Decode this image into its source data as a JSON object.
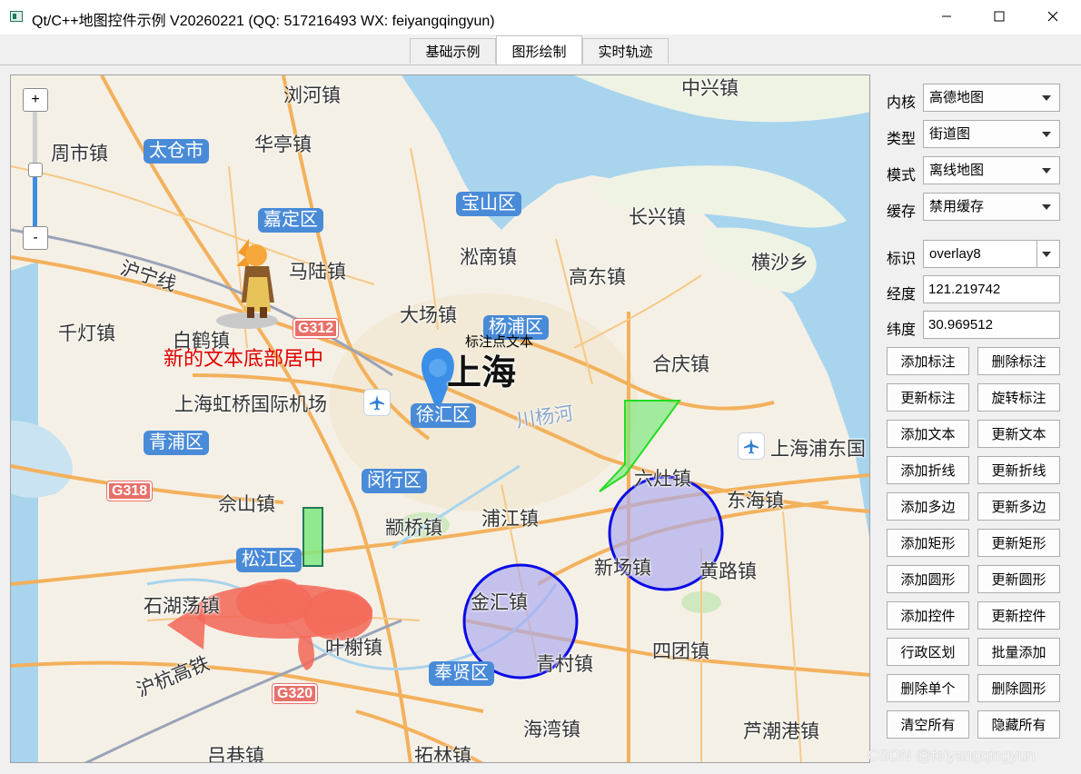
{
  "window": {
    "title": "Qt/C++地图控件示例 V20260221 (QQ: 517216493 WX: feiyangqingyun)"
  },
  "tabs": [
    {
      "label": "基础示例",
      "active": false
    },
    {
      "label": "图形绘制",
      "active": true
    },
    {
      "label": "实时轨迹",
      "active": false
    }
  ],
  "map": {
    "zoom_in": "+",
    "zoom_out": "-",
    "zoom_level_fraction": 0.5,
    "places": [
      "浏河镇",
      "中兴镇",
      "周市镇",
      "太仓市",
      "华亭镇",
      "宝山区",
      "长兴镇",
      "嘉定区",
      "淞南镇",
      "横沙乡",
      "沪宁线",
      "马陆镇",
      "高东镇",
      "千灯镇",
      "白鹤镇",
      "G312",
      "大场镇",
      "杨浦区",
      "上海",
      "合庆镇",
      "上海虹桥国际机场",
      "徐汇区",
      "川杨河",
      "青浦区",
      "上海浦东国",
      "闵行区",
      "六灶镇",
      "G318",
      "佘山镇",
      "东海镇",
      "颛桥镇",
      "浦江镇",
      "松江区",
      "新场镇",
      "黄路镇",
      "石湖荡镇",
      "金汇镇",
      "叶榭镇",
      "青村镇",
      "四团镇",
      "沪杭高铁",
      "奉贤区",
      "G320",
      "海湾镇",
      "芦潮港镇",
      "吕巷镇",
      "拓林镇"
    ],
    "marker_label": "标注点文本",
    "red_text": "新的文本底部居中",
    "watermark": "CSDN @feiyangqingyun",
    "colors": {
      "water": "#a8d4ee",
      "land": "#f5f0e6",
      "polygon": "#33dd33",
      "rect_fill": "#7fe87f",
      "circle_stroke": "#0a0ae6",
      "circle_fill": "#a9a9f0",
      "fish": "#f36a5a",
      "marker": "#3b8fe8",
      "text_red": "#e00000"
    }
  },
  "panel": {
    "kernel": {
      "label": "内核",
      "value": "高德地图"
    },
    "type": {
      "label": "类型",
      "value": "街道图"
    },
    "mode": {
      "label": "模式",
      "value": "离线地图"
    },
    "cache": {
      "label": "缓存",
      "value": "禁用缓存"
    },
    "marker_id": {
      "label": "标识",
      "value": "overlay8"
    },
    "longitude": {
      "label": "经度",
      "value": "121.219742"
    },
    "latitude": {
      "label": "纬度",
      "value": "30.969512"
    },
    "buttons": [
      [
        "添加标注",
        "删除标注"
      ],
      [
        "更新标注",
        "旋转标注"
      ],
      [
        "添加文本",
        "更新文本"
      ],
      [
        "添加折线",
        "更新折线"
      ],
      [
        "添加多边",
        "更新多边"
      ],
      [
        "添加矩形",
        "更新矩形"
      ],
      [
        "添加圆形",
        "更新圆形"
      ],
      [
        "添加控件",
        "更新控件"
      ],
      [
        "行政区划",
        "批量添加"
      ],
      [
        "删除单个",
        "删除圆形"
      ],
      [
        "清空所有",
        "隐藏所有"
      ]
    ]
  }
}
